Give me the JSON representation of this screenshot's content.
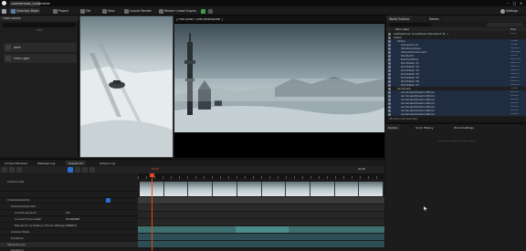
{
  "titlebar": {
    "project_tab": "SubfeletonAv_SnowPlanet"
  },
  "toolbar": {
    "mode": "Selection Mode",
    "project": "Project",
    "file": "File",
    "view": "View",
    "launch": "Launch Render",
    "render": "Render Unreal Engine",
    "settings": "Settings"
  },
  "places": {
    "header": "Place Actors",
    "items": [
      {
        "label": "Note"
      },
      {
        "label": "Point Light"
      }
    ]
  },
  "viewport": {
    "camera_label": "[ Pilot Actor: CineCameraActor ]"
  },
  "outliner": {
    "tabs": [
      "World Outliner",
      "Details"
    ],
    "columns": {
      "label": "Item Label",
      "type": "Type"
    },
    "rows": [
      {
        "name": "SubfeletonAv_SnowPlanet (Persistent_W...)",
        "type": "World"
      },
      {
        "name": "Spawn",
        "type": ""
      },
      {
        "name": "Atmos",
        "type": "Folder"
      },
      {
        "name": "SceneCore All",
        "type": "Folder"
      },
      {
        "name": "SkyAtmosphere",
        "type": "Sky Atm"
      },
      {
        "name": "SkyLightComponent",
        "type": "SkyLight"
      },
      {
        "name": "PointLight",
        "type": "PointL"
      },
      {
        "name": "ExpHeightFog",
        "type": "ExpHFog"
      },
      {
        "name": "RockDetail_01",
        "type": "StaticM"
      },
      {
        "name": "RockDetail_02",
        "type": "StaticM"
      },
      {
        "name": "RockDetail_03",
        "type": "StaticM"
      },
      {
        "name": "RockDetail_04",
        "type": "StaticM"
      },
      {
        "name": "RockDetail_05",
        "type": "StaticM"
      },
      {
        "name": "RockDetail_06",
        "type": "StaticM"
      },
      {
        "name": "RockDetail_07",
        "type": "StaticM"
      },
      {
        "name": "Landscape",
        "type": "Folder"
      },
      {
        "name": "LandscapeStreamingProxy",
        "type": "Landsc"
      },
      {
        "name": "LandscapeStreamingProxy",
        "type": "Landsc"
      },
      {
        "name": "LandscapeStreamingProxy",
        "type": "Landsc"
      },
      {
        "name": "LandscapeStreamingProxy",
        "type": "Landsc"
      },
      {
        "name": "LandscapeStreamingProxy",
        "type": "Landsc"
      },
      {
        "name": "LandscapeStreamingProxy",
        "type": "Landsc"
      },
      {
        "name": "LandscapeStreamingProxy",
        "type": "Landsc"
      }
    ],
    "count": "48 actors (45 selected)"
  },
  "details": {
    "tabs": [
      "Details",
      "Undo History",
      "World Settings"
    ],
    "empty_hint": "Select an object to view details"
  },
  "sequencer": {
    "tabs": [
      "Content Browser",
      "Message Log",
      "Sequencer",
      "Output Log"
    ],
    "time_start": "0000",
    "time_end": "0146",
    "tracks": [
      {
        "label": "Camera Cuts"
      },
      {
        "label": ""
      },
      {
        "label": "CineCameraActor"
      },
      {
        "label": "CameraComponent"
      },
      {
        "label": "Current Aperture"
      },
      {
        "label": "Current Focal Length"
      },
      {
        "label": "Manual Focus Distance (Focus Settings)"
      },
      {
        "label": "Camera Shake"
      },
      {
        "label": "Transform"
      },
      {
        "label": "SphereOut_01"
      },
      {
        "label": "Transform"
      }
    ],
    "values": [
      "2.8",
      "24.000000",
      "10000.0"
    ]
  },
  "colors": {
    "accent": "#2b6fd6",
    "playhead": "#e04a1c",
    "track_bar": "#4a8b8b"
  }
}
